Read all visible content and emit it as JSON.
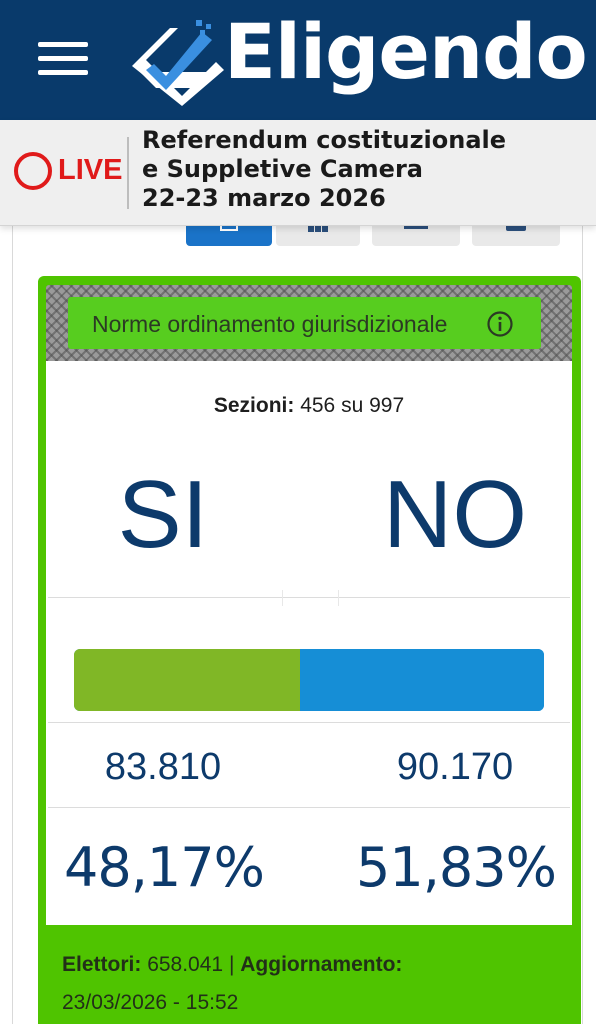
{
  "header": {
    "app_title": "Eligendo",
    "menu_icon": "hamburger-menu-icon",
    "logo_icon": "ballot-check-logo-icon",
    "colors": {
      "background": "#093a6b",
      "text": "#ffffff"
    }
  },
  "live_banner": {
    "live_label": "LIVE",
    "title_line1": "Referendum costituzionale",
    "title_line2": "e Suppletive Camera",
    "title_line3": "22-23 marzo 2026",
    "colors": {
      "live": "#e01a1a",
      "background": "#efefef"
    }
  },
  "tabs": [
    {
      "icon": "tab-icon-1",
      "active": true
    },
    {
      "icon": "bar-chart-icon",
      "active": false
    },
    {
      "icon": "list-icon",
      "active": false
    },
    {
      "icon": "dropdown-icon",
      "active": false
    }
  ],
  "result_card": {
    "topic": "Norme ordinamento giurisdizionale",
    "info_icon": "info-icon",
    "sezioni_label": "Sezioni:",
    "sezioni_value": "456 su 997",
    "choices": {
      "si_label": "SI",
      "no_label": "NO"
    },
    "bar": {
      "si_fraction": 0.4817,
      "no_fraction": 0.5183
    },
    "votes": {
      "si": "83.810",
      "no": "90.170"
    },
    "percentages": {
      "si": "48,17%",
      "no": "51,83%"
    },
    "elettori_label": "Elettori:",
    "elettori_value": "658.041",
    "separator": "|",
    "aggiornamento_label": "Aggiornamento:",
    "aggiornamento_value": "23/03/2026 - 15:52",
    "colors": {
      "card_border": "#4fc400",
      "si_bar": "#80b726",
      "no_bar": "#168ed6",
      "text": "#0d3a6b"
    }
  }
}
